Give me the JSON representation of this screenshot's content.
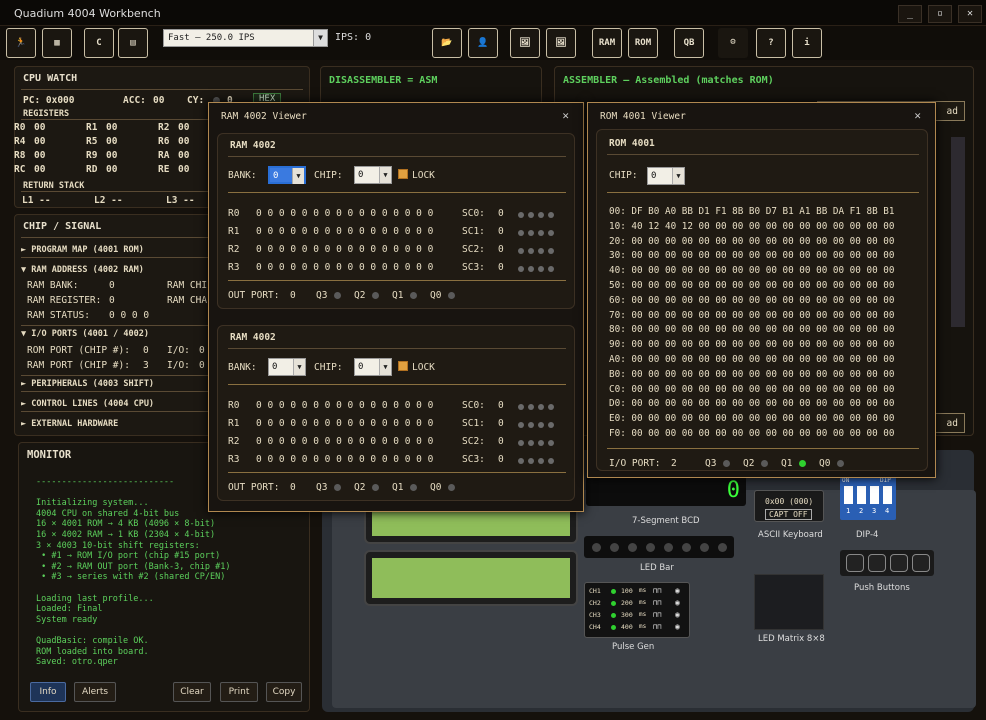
{
  "window": {
    "title": "Quadium 4004 Workbench",
    "min": "_",
    "max": "▫",
    "close": "✕"
  },
  "toolbar": {
    "speed": "Fast       –   250.0 IPS",
    "ips_label": "IPS:",
    "ips_value": "0",
    "ram": "RAM",
    "rom": "ROM",
    "qb": "QB"
  },
  "cpu_watch": {
    "title": "CPU WATCH",
    "pc": "PC: 0x000",
    "acc": "ACC:",
    "acc_value": "00",
    "cy": "CY:",
    "cy_value": "0",
    "hex": "HEX",
    "registers_label": "REGISTERS",
    "registers": [
      [
        "R0",
        "00"
      ],
      [
        "R1",
        "00"
      ],
      [
        "R2",
        "00"
      ],
      [
        "R4",
        "00"
      ],
      [
        "R5",
        "00"
      ],
      [
        "R6",
        "00"
      ],
      [
        "R8",
        "00"
      ],
      [
        "R9",
        "00"
      ],
      [
        "RA",
        "00"
      ],
      [
        "RC",
        "00"
      ],
      [
        "RD",
        "00"
      ],
      [
        "RE",
        "00"
      ]
    ],
    "stack_label": "RETURN STACK",
    "stack": [
      [
        "L1",
        "--"
      ],
      [
        "L2",
        "--"
      ],
      [
        "L3",
        "--"
      ]
    ]
  },
  "chip_signal": {
    "title": "CHIP / SIGNAL",
    "program_map": "► PROGRAM MAP (4001 ROM)",
    "ram_address": "▼ RAM ADDRESS (4002 RAM)",
    "ram_bank": "RAM BANK:",
    "ram_bank_v": "0",
    "ram_register": "RAM REGISTER:",
    "ram_register_v": "0",
    "ram_status": "RAM STATUS:",
    "ram_status_v": "0 0 0 0",
    "ram_chi": "RAM CHI",
    "ram_cha": "RAM CHA",
    "io_ports": "▼ I/O PORTS (4001 / 4002)",
    "rom_port": "ROM PORT (CHIP #):",
    "rom_port_v": "0",
    "ram_port": "RAM PORT (CHIP #):",
    "ram_port_v": "3",
    "io1": "I/O:",
    "io1_v": "0",
    "io2": "I/O:",
    "io2_v": "0",
    "peripherals": "► PERIPHERALS (4003 SHIFT)",
    "control": "► CONTROL LINES (4004 CPU)",
    "external": "► EXTERNAL HARDWARE"
  },
  "disasm": {
    "title": "DISASSEMBLER = ASM"
  },
  "assembler": {
    "title": "ASSEMBLER – Assembled (matches ROM)",
    "frag1": "ad",
    "frag2": "ad"
  },
  "ram_viewer": {
    "title": "RAM 4002 Viewer",
    "close": "✕",
    "blocks": [
      {
        "title": "RAM 4002",
        "bank_label": "BANK:",
        "bank": "0",
        "chip_label": "CHIP:",
        "chip": "0",
        "lock": "LOCK",
        "rows": [
          {
            "r": "R0",
            "v": "0 0 0 0 0 0 0 0 0 0 0 0 0 0 0 0",
            "sc": "SC0:",
            "sv": "0"
          },
          {
            "r": "R1",
            "v": "0 0 0 0 0 0 0 0 0 0 0 0 0 0 0 0",
            "sc": "SC1:",
            "sv": "0"
          },
          {
            "r": "R2",
            "v": "0 0 0 0 0 0 0 0 0 0 0 0 0 0 0 0",
            "sc": "SC2:",
            "sv": "0"
          },
          {
            "r": "R3",
            "v": "0 0 0 0 0 0 0 0 0 0 0 0 0 0 0 0",
            "sc": "SC3:",
            "sv": "0"
          }
        ],
        "out": "OUT PORT:",
        "out_v": "0",
        "q": [
          "Q3",
          "Q2",
          "Q1",
          "Q0"
        ]
      },
      {
        "title": "RAM 4002",
        "bank_label": "BANK:",
        "bank": "0",
        "chip_label": "CHIP:",
        "chip": "0",
        "lock": "LOCK",
        "rows": [
          {
            "r": "R0",
            "v": "0 0 0 0 0 0 0 0 0 0 0 0 0 0 0 0",
            "sc": "SC0:",
            "sv": "0"
          },
          {
            "r": "R1",
            "v": "0 0 0 0 0 0 0 0 0 0 0 0 0 0 0 0",
            "sc": "SC1:",
            "sv": "0"
          },
          {
            "r": "R2",
            "v": "0 0 0 0 0 0 0 0 0 0 0 0 0 0 0 0",
            "sc": "SC2:",
            "sv": "0"
          },
          {
            "r": "R3",
            "v": "0 0 0 0 0 0 0 0 0 0 0 0 0 0 0 0",
            "sc": "SC3:",
            "sv": "0"
          }
        ],
        "out": "OUT PORT:",
        "out_v": "0",
        "q": [
          "Q3",
          "Q2",
          "Q1",
          "Q0"
        ]
      }
    ]
  },
  "rom_viewer": {
    "title": "ROM 4001 Viewer",
    "close": "✕",
    "sub_title": "ROM 4001",
    "chip_label": "CHIP:",
    "chip": "0",
    "lines": [
      "00: DF B0 A0 BB D1 F1 8B B0 D7 B1 A1 BB DA F1 8B B1",
      "10: 40 12 40 12 00 00 00 00 00 00 00 00 00 00 00 00",
      "20: 00 00 00 00 00 00 00 00 00 00 00 00 00 00 00 00",
      "30: 00 00 00 00 00 00 00 00 00 00 00 00 00 00 00 00",
      "40: 00 00 00 00 00 00 00 00 00 00 00 00 00 00 00 00",
      "50: 00 00 00 00 00 00 00 00 00 00 00 00 00 00 00 00",
      "60: 00 00 00 00 00 00 00 00 00 00 00 00 00 00 00 00",
      "70: 00 00 00 00 00 00 00 00 00 00 00 00 00 00 00 00",
      "80: 00 00 00 00 00 00 00 00 00 00 00 00 00 00 00 00",
      "90: 00 00 00 00 00 00 00 00 00 00 00 00 00 00 00 00",
      "A0: 00 00 00 00 00 00 00 00 00 00 00 00 00 00 00 00",
      "B0: 00 00 00 00 00 00 00 00 00 00 00 00 00 00 00 00",
      "C0: 00 00 00 00 00 00 00 00 00 00 00 00 00 00 00 00",
      "D0: 00 00 00 00 00 00 00 00 00 00 00 00 00 00 00 00",
      "E0: 00 00 00 00 00 00 00 00 00 00 00 00 00 00 00 00",
      "F0: 00 00 00 00 00 00 00 00 00 00 00 00 00 00 00 00"
    ],
    "io": "I/O PORT:",
    "io_v": "2",
    "q": [
      "Q3",
      "Q2",
      "Q1",
      "Q0"
    ]
  },
  "monitor": {
    "title": "MONITOR",
    "text": "---------------------------\n\nInitializing system...\n4004 CPU on shared 4-bit bus\n16 × 4001 ROM → 4 KB (4096 × 8-bit)\n16 × 4002 RAM → 1 KB (2304 × 4-bit)\n3 × 4003 10-bit shift registers:\n • #1 → ROM I/O port (chip #15 port)\n • #2 → RAM OUT port (Bank-3, chip #1)\n • #3 → series with #2 (shared CP/EN)\n\nLoading last profile...\nLoaded: Final\nSystem ready\n\nQuadBasic: compile OK.\nROM loaded into board.\nSaved: otro.qper",
    "buttons": {
      "info": "Info",
      "alerts": "Alerts",
      "clear": "Clear",
      "print": "Print",
      "copy": "Copy"
    }
  },
  "peripherals": {
    "seg": "7-Segment BCD",
    "ascii_value": "0x00 (000)",
    "capt": "CAPT OFF",
    "ascii": "ASCII Keyboard",
    "dip": "DIP-4",
    "dip_on": "ON",
    "dip_name": "DIP",
    "dip_nums": [
      "1",
      "2",
      "3",
      "4"
    ],
    "ledbar": "LED Bar",
    "push": "Push Buttons",
    "pulse": "Pulse Gen",
    "matrix": "LED Matrix 8×8",
    "pulse_rows": [
      {
        "ch": "CH1",
        "f": "100",
        "u": "ms"
      },
      {
        "ch": "CH2",
        "f": "200",
        "u": "ms"
      },
      {
        "ch": "CH3",
        "f": "300",
        "u": "ms"
      },
      {
        "ch": "CH4",
        "f": "400",
        "u": "ms"
      }
    ]
  }
}
